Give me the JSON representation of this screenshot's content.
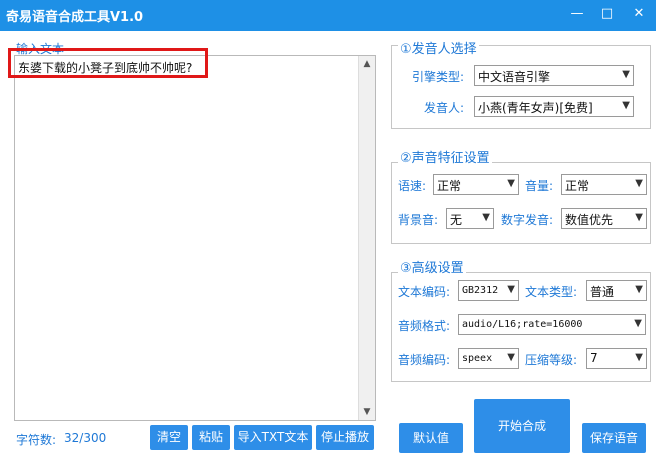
{
  "window": {
    "title": "奇易语音合成工具V1.0"
  },
  "text_input": {
    "label": "输入文本",
    "value": "东婆下载的小凳子到底帅不帅呢?"
  },
  "char_count": {
    "label": "字符数:",
    "value": "32/300"
  },
  "text_buttons": {
    "clear": "清空",
    "paste": "粘贴",
    "import_txt": "导入TXT文本",
    "stop": "停止播放"
  },
  "speaker": {
    "title": "①发音人选择",
    "engine_label": "引擎类型:",
    "engine_value": "中文语音引擎",
    "voice_label": "发音人:",
    "voice_value": "小燕(青年女声)[免费]"
  },
  "voice_features": {
    "title": "②声音特征设置",
    "speed_label": "语速:",
    "speed_value": "正常",
    "volume_label": "音量:",
    "volume_value": "正常",
    "bgm_label": "背景音:",
    "bgm_value": "无",
    "digit_label": "数字发音:",
    "digit_value": "数值优先"
  },
  "advanced": {
    "title": "③高级设置",
    "encoding_label": "文本编码:",
    "encoding_value": "GB2312",
    "texttype_label": "文本类型:",
    "texttype_value": "普通",
    "format_label": "音频格式:",
    "format_value": "audio/L16;rate=16000",
    "audioenc_label": "音频编码:",
    "audioenc_value": "speex",
    "compress_label": "压缩等级:",
    "compress_value": "7"
  },
  "actions": {
    "default": "默认值",
    "start": "开始合成",
    "save": "保存语音"
  },
  "colors": {
    "titlebar": "#1e90e6",
    "accent": "#1e78d6",
    "button": "#2e8ee8",
    "highlight_box": "#e01818"
  }
}
